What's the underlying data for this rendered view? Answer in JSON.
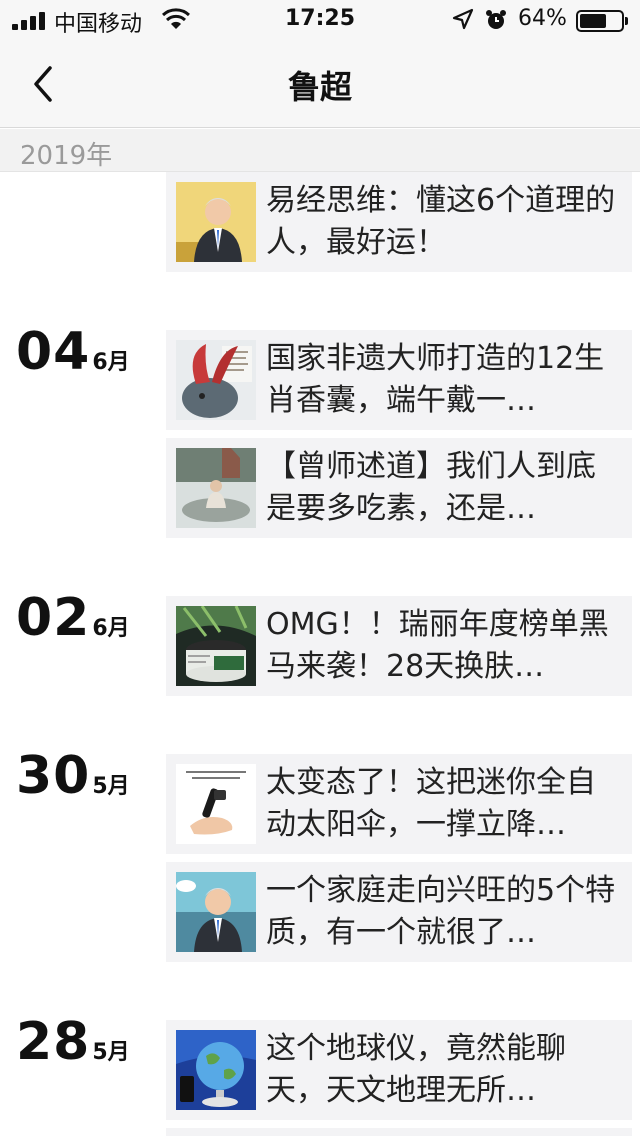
{
  "status_bar": {
    "carrier": "中国移动",
    "time": "17:25",
    "battery": "64%",
    "battery_level": 0.64
  },
  "nav": {
    "title": "鲁超"
  },
  "year": "2019年",
  "groups": [
    {
      "day": "",
      "month": "",
      "articles": [
        {
          "title": "易经思维：懂这6个道理的人，最好运！",
          "thumb_icon": "man-portrait-thumbnail"
        }
      ]
    },
    {
      "day": "04",
      "month": "6月",
      "articles": [
        {
          "title": "国家非遗大师打造的12生肖香囊，端午戴一…",
          "thumb_icon": "sachet-thumbnail"
        },
        {
          "title": "【曾师述道】我们人到底是要多吃素，还是…",
          "thumb_icon": "meditation-thumbnail"
        }
      ]
    },
    {
      "day": "02",
      "month": "6月",
      "articles": [
        {
          "title": "OMG！！瑞丽年度榜单黑马来袭！28天换肤…",
          "thumb_icon": "cream-jar-thumbnail"
        }
      ]
    },
    {
      "day": "30",
      "month": "5月",
      "articles": [
        {
          "title": "太变态了！这把迷你全自动太阳伞，一撑立降…",
          "thumb_icon": "umbrella-thumbnail"
        },
        {
          "title": "一个家庭走向兴旺的5个特质，有一个就很了…",
          "thumb_icon": "man-portrait-thumbnail"
        }
      ]
    },
    {
      "day": "28",
      "month": "5月",
      "articles": [
        {
          "title": "这个地球仪，竟然能聊天，天文地理无所…",
          "thumb_icon": "globe-thumbnail"
        }
      ]
    }
  ]
}
